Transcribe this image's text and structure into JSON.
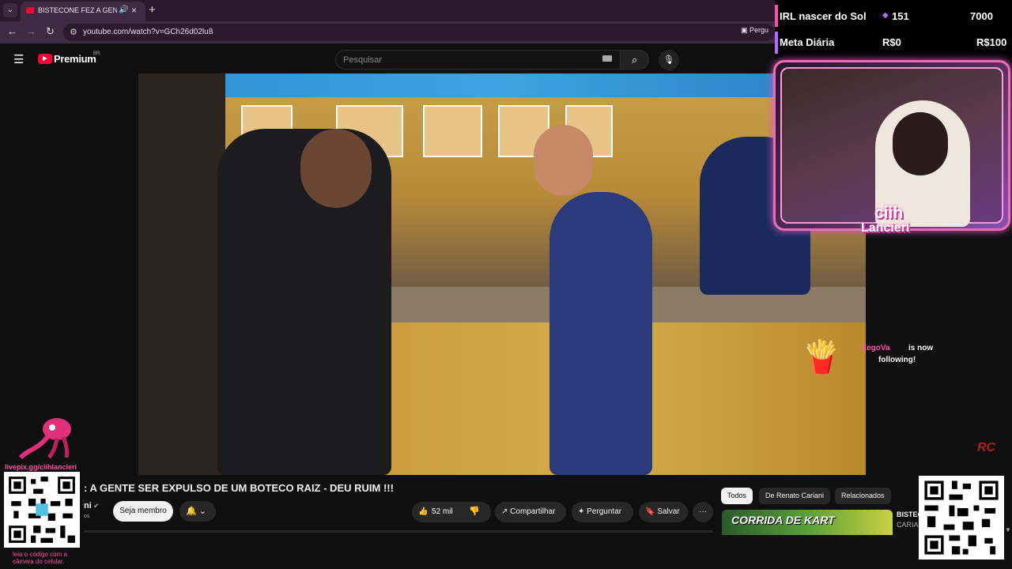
{
  "browser": {
    "tab_title": "BISTECONE FEZ A GENTE SER EXPULSO",
    "url": "youtube.com/watch?v=GCh26d02lu8",
    "ask_label": "Pergu"
  },
  "youtube": {
    "brand": "Premium",
    "country": "BR",
    "search_placeholder": "Pesquisar"
  },
  "video": {
    "title": ": A GENTE SER EXPULSO DE UM BOTECO RAIZ - DEU RUIM !!!",
    "channel_fragment": "ni",
    "subs_fragment": "os",
    "join_label": "Seja membro",
    "like_count": "52 mil",
    "share_label": "Compartilhar",
    "ask_label": "Perguntar",
    "save_label": "Salvar",
    "watermark": "RC"
  },
  "chips": {
    "all": "Todos",
    "channel": "De Renato Cariani",
    "related": "Relacionados"
  },
  "recommendation": {
    "thumb_text": "CORRIDA DE KART",
    "title_1": "BISTEC",
    "title_2": "CARIA"
  },
  "overlay": {
    "goal1_label": "IRL nascer do Sol",
    "goal1_count": "151",
    "goal1_target": "7000",
    "goal2_label": "Meta Diária",
    "goal2_current": "R$0",
    "goal2_target": "R$100",
    "streamer_name_1": "ciih",
    "streamer_name_2": "Lancieri",
    "follow_user": "ZegoVa",
    "follow_text_1": "is now",
    "follow_text_2": "following!",
    "livepix_url": "livepix.gg/ciihlancieri",
    "qr_caption_1": "leia o código com a",
    "qr_caption_2": "câmera do celular."
  },
  "colors": {
    "yt_red": "#ff0033",
    "overlay_pink": "#ff4fa8",
    "overlay_purple": "#b36bff",
    "browser_frame": "#3f2a43"
  }
}
